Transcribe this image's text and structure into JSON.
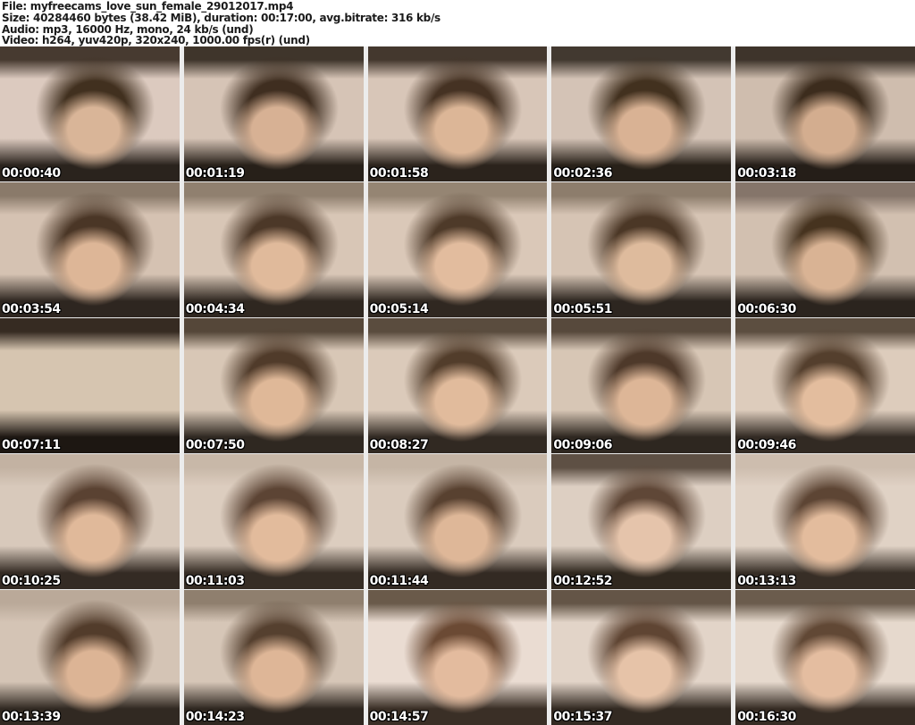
{
  "header": {
    "lines": [
      "File: myfreecams_love_sun_female_29012017.mp4",
      "Size: 40284460 bytes (38.42 MiB), duration: 00:17:00, avg.bitrate: 316 kb/s",
      "Audio: mp3, 16000 Hz, mono, 24 kb/s (und)",
      "Video: h264, yuv420p, 320x240, 1000.00 fps(r) (und)"
    ]
  },
  "grid": {
    "rows": 5,
    "columns": 5,
    "thumbnails": [
      {
        "timestamp": "00:00:40",
        "palette": {
          "top": "#473a30",
          "wall": "#dccabf",
          "hair": "#41301f",
          "skin": "#d9b598",
          "bottom": "#2a231d"
        }
      },
      {
        "timestamp": "00:01:19",
        "palette": {
          "top": "#3f352b",
          "wall": "#d6c4b6",
          "hair": "#3f2e20",
          "skin": "#d7b194",
          "bottom": "#272019"
        }
      },
      {
        "timestamp": "00:01:58",
        "palette": {
          "top": "#44382e",
          "wall": "#d8c6b8",
          "hair": "#453223",
          "skin": "#dcb697",
          "bottom": "#2b231c"
        }
      },
      {
        "timestamp": "00:02:36",
        "palette": {
          "top": "#423930",
          "wall": "#d4c3b6",
          "hair": "#42311f",
          "skin": "#d9b294",
          "bottom": "#282119"
        }
      },
      {
        "timestamp": "00:03:18",
        "palette": {
          "top": "#3e342b",
          "wall": "#cfbdae",
          "hair": "#3c2c1d",
          "skin": "#d3ad8f",
          "bottom": "#251e18"
        }
      },
      {
        "timestamp": "00:03:54",
        "palette": {
          "top": "#8a7a6a",
          "wall": "#d5c2b2",
          "hair": "#4a3626",
          "skin": "#ddb697",
          "bottom": "#2e2620"
        }
      },
      {
        "timestamp": "00:04:34",
        "palette": {
          "top": "#90806f",
          "wall": "#d8c6b6",
          "hair": "#4c3828",
          "skin": "#e0ba9b",
          "bottom": "#2f2720"
        }
      },
      {
        "timestamp": "00:05:14",
        "palette": {
          "top": "#958573",
          "wall": "#dac8b8",
          "hair": "#4e3a29",
          "skin": "#e2bc9e",
          "bottom": "#302821"
        }
      },
      {
        "timestamp": "00:05:51",
        "palette": {
          "top": "#8d7d6c",
          "wall": "#d6c4b4",
          "hair": "#4b3726",
          "skin": "#debb9d",
          "bottom": "#2d2620"
        }
      },
      {
        "timestamp": "00:06:30",
        "palette": {
          "top": "#85756a",
          "wall": "#d2c0b0",
          "hair": "#46331f",
          "skin": "#d9b394",
          "bottom": "#2b241e"
        }
      },
      {
        "timestamp": "00:07:11",
        "palette": {
          "top": "#362b22",
          "wall": "#d6c5b0",
          "hair": null,
          "skin": null,
          "bottom": "#1d1712"
        }
      },
      {
        "timestamp": "00:07:50",
        "palette": {
          "top": "#554739",
          "wall": "#d8c7b6",
          "hair": "#503b2a",
          "skin": "#dfb898",
          "bottom": "#2f2821"
        }
      },
      {
        "timestamp": "00:08:27",
        "palette": {
          "top": "#5a4c3e",
          "wall": "#dbcaba",
          "hair": "#523d2b",
          "skin": "#e1bb9c",
          "bottom": "#312922"
        }
      },
      {
        "timestamp": "00:09:06",
        "palette": {
          "top": "#57493c",
          "wall": "#d7c6b5",
          "hair": "#4e392a",
          "skin": "#ddb697",
          "bottom": "#2e2720"
        }
      },
      {
        "timestamp": "00:09:46",
        "palette": {
          "top": "#5c4e40",
          "wall": "#ddccbc",
          "hair": "#543f2d",
          "skin": "#e3bd9e",
          "bottom": "#322a23"
        }
      },
      {
        "timestamp": "00:10:25",
        "palette": {
          "top": "#c3b2a2",
          "wall": "#d8c9bb",
          "hair": "#5a4232",
          "skin": "#e0b99a",
          "bottom": "#342b24"
        }
      },
      {
        "timestamp": "00:11:03",
        "palette": {
          "top": "#c8b8a8",
          "wall": "#dccdbf",
          "hair": "#5c4434",
          "skin": "#e2bb9c",
          "bottom": "#362d25"
        }
      },
      {
        "timestamp": "00:11:44",
        "palette": {
          "top": "#c5b5a5",
          "wall": "#dacbbd",
          "hair": "#584130",
          "skin": "#deb798",
          "bottom": "#332a23"
        }
      },
      {
        "timestamp": "00:12:52",
        "palette": {
          "top": "#5e5044",
          "wall": "#ddcfc2",
          "hair": "#5f4737",
          "skin": "#e5c4ab",
          "bottom": "#30281f"
        }
      },
      {
        "timestamp": "00:13:13",
        "palette": {
          "top": "#cdbdae",
          "wall": "#e0d2c5",
          "hair": "#5d4534",
          "skin": "#e3bc9d",
          "bottom": "#372e26"
        }
      },
      {
        "timestamp": "00:13:39",
        "palette": {
          "top": "#baa999",
          "wall": "#d4c4b5",
          "hair": "#523c2b",
          "skin": "#dcb495",
          "bottom": "#312922"
        }
      },
      {
        "timestamp": "00:14:23",
        "palette": {
          "top": "#8f7f6e",
          "wall": "#d6c6b7",
          "hair": "#55402f",
          "skin": "#deb697",
          "bottom": "#2f2720"
        }
      },
      {
        "timestamp": "00:14:57",
        "palette": {
          "top": "#6a5a4a",
          "wall": "#eadcd2",
          "hair": "#6b4a34",
          "skin": "#e3bb9e",
          "bottom": "#3a2f26"
        }
      },
      {
        "timestamp": "00:15:37",
        "palette": {
          "top": "#645547",
          "wall": "#e2d4c8",
          "hair": "#5f4533",
          "skin": "#e6c3a8",
          "bottom": "#332a22"
        }
      },
      {
        "timestamp": "00:16:30",
        "palette": {
          "top": "#6b5c4d",
          "wall": "#e6d9cd",
          "hair": "#614835",
          "skin": "#e4bda0",
          "bottom": "#362c24"
        }
      }
    ]
  },
  "colors": {
    "page_background": "#ffffff",
    "header_text": "#1b1b1b",
    "grid_gap": "#ececec",
    "timestamp_text": "#ffffff",
    "timestamp_outline": "#000000"
  }
}
